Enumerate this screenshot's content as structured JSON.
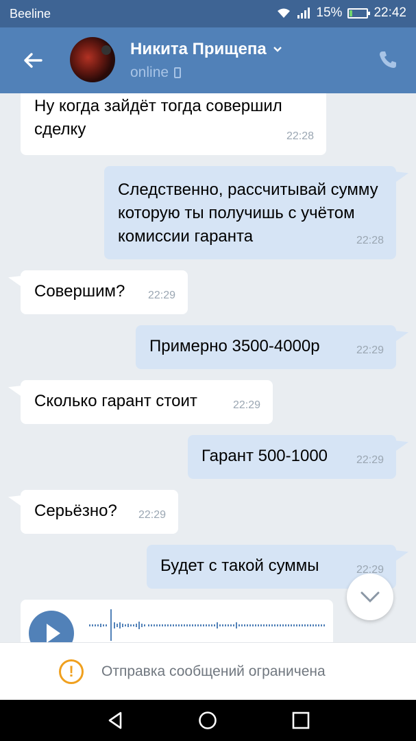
{
  "status_bar": {
    "carrier": "Beeline",
    "battery": "15%",
    "time": "22:42",
    "battery_level": 0.15
  },
  "header": {
    "contact_name": "Никита Прищепа",
    "status": "online"
  },
  "messages": [
    {
      "direction": "in",
      "text": "Ну когда зайдёт тогда совершил сделку",
      "time": "22:28"
    },
    {
      "direction": "out",
      "text": "Следственно, рассчитывай сумму которую ты получишь с учётом комиссии гаранта",
      "time": "22:28"
    },
    {
      "direction": "in",
      "text": "Совершим?",
      "time": "22:29"
    },
    {
      "direction": "out",
      "text": "Примерно 3500-4000р",
      "time": "22:29"
    },
    {
      "direction": "in",
      "text": "Сколько гарант стоит",
      "time": "22:29"
    },
    {
      "direction": "out",
      "text": "Гарант 500-1000",
      "time": "22:29"
    },
    {
      "direction": "in",
      "text": "Серьёзно?",
      "time": "22:29"
    },
    {
      "direction": "out",
      "text": "Будет с такой суммы",
      "time": "22:29"
    }
  ],
  "restricted_notice": "Отправка сообщений ограничена",
  "colors": {
    "header": "#5181b8",
    "status_bar": "#3e6494",
    "outgoing_bubble": "#d6e4f5",
    "incoming_bubble": "#ffffff",
    "warning": "#f0a01e"
  },
  "icons": [
    "back-arrow-icon",
    "chevron-down-icon",
    "mobile-icon",
    "phone-icon",
    "play-icon",
    "scroll-down-icon",
    "warning-icon",
    "nav-back-icon",
    "nav-home-icon",
    "nav-recents-icon"
  ]
}
